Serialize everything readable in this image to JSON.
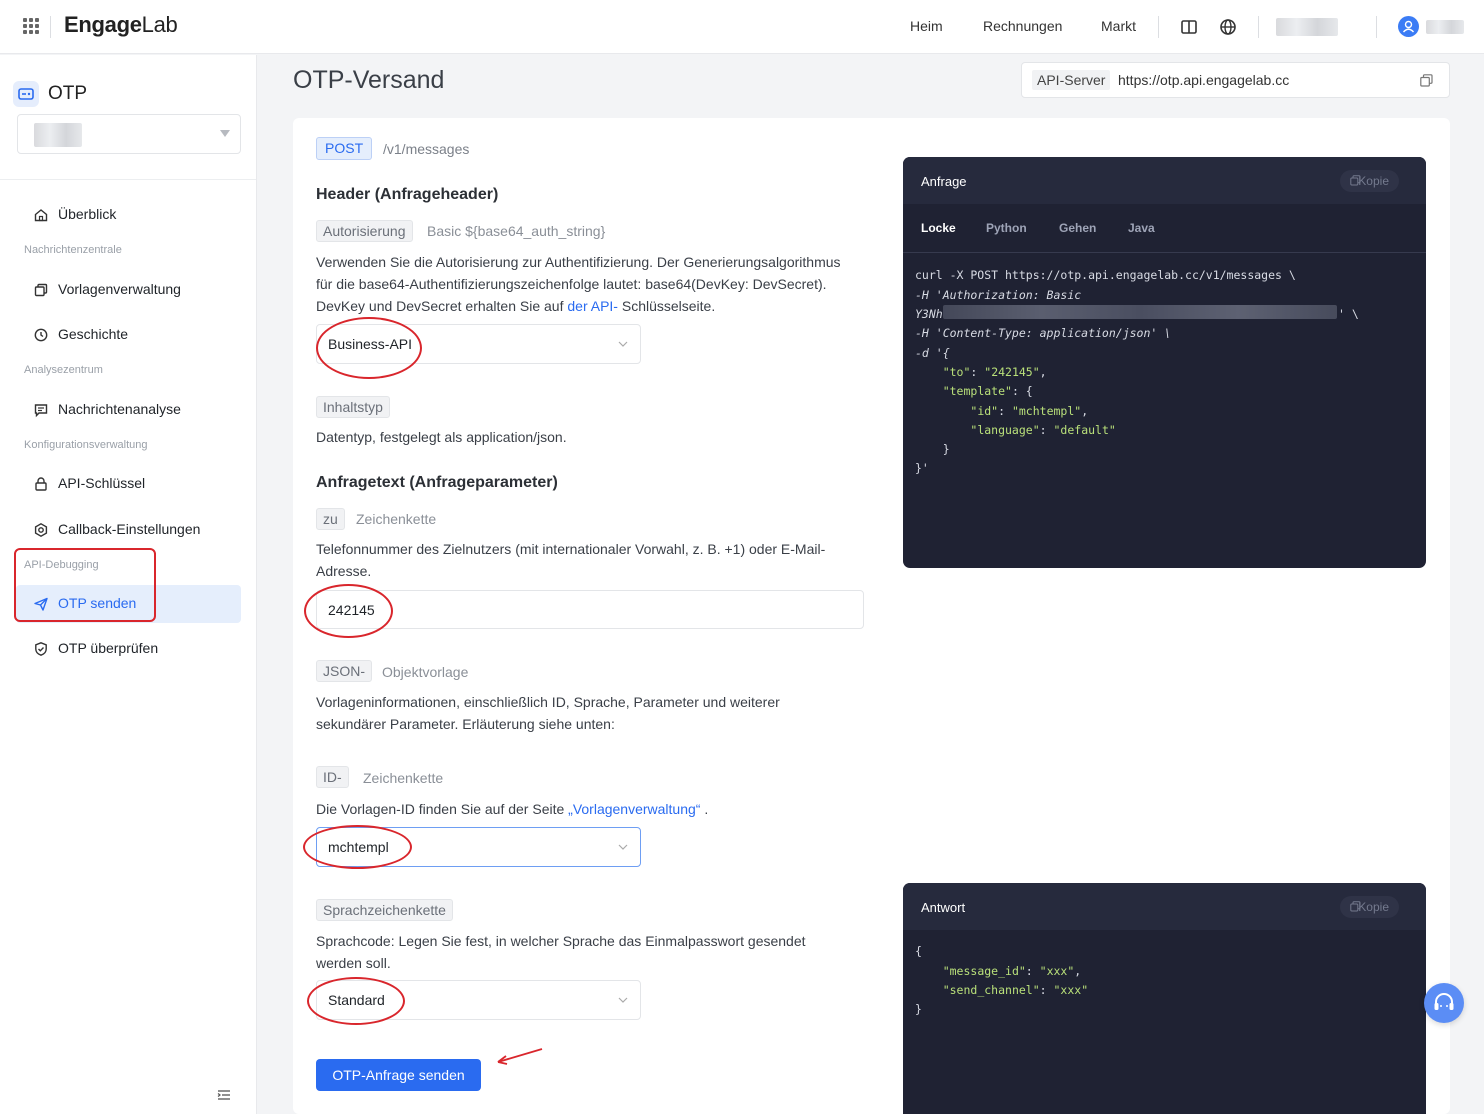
{
  "brand": {
    "logo_main": "Engage",
    "logo_lab": "Lab"
  },
  "topnav": {
    "home": "Heim",
    "billing": "Rechnungen",
    "market": "Markt"
  },
  "sidebar": {
    "product": "OTP",
    "groups": {
      "message_center": "Nachrichtenzentrale",
      "analytics": "Analysezentrum",
      "config": "Konfigurationsverwaltung",
      "api_debug": "API-Debugging"
    },
    "items": {
      "overview": "Überblick",
      "templates": "Vorlagenverwaltung",
      "history": "Geschichte",
      "msg_analysis": "Nachrichtenanalyse",
      "api_keys": "API-Schlüssel",
      "callback": "Callback-Einstellungen",
      "send_otp": "OTP senden",
      "verify_otp": "OTP überprüfen"
    }
  },
  "page": {
    "title": "OTP-Versand"
  },
  "api_server": {
    "label": "API-Server",
    "url": "https://otp.api.engagelab.cc"
  },
  "request": {
    "method": "POST",
    "path": "/v1/messages",
    "header_title": "Header (Anfrageheader)",
    "auth": {
      "name": "Autorisierung",
      "type": "Basic ${base64_auth_string}",
      "desc1": "Verwenden Sie die Autorisierung zur Authentifizierung. Der Generierungsalgorithmus",
      "desc2": "für die base64-Authentifizierungszeichenfolge lautet: base64(DevKey: DevSecret).",
      "desc3_pre": "DevKey und DevSecret erhalten Sie auf ",
      "desc3_link": "der API-",
      "desc3_post": " Schlüsselseite.",
      "select_value": "Business-API"
    },
    "content_type": {
      "name": "Inhaltstyp",
      "desc": "Datentyp, festgelegt als application/json."
    },
    "body_title": "Anfragetext (Anfrageparameter)",
    "to": {
      "name": "zu",
      "type": "Zeichenkette",
      "desc1": "Telefonnummer des Zielnutzers (mit internationaler Vorwahl, z. B. +1) oder E-Mail-",
      "desc2": "Adresse.",
      "value": "242145"
    },
    "template": {
      "name": "JSON-",
      "type": "Objektvorlage",
      "desc1": "Vorlageninformationen, einschließlich ID, Sprache, Parameter und weiterer",
      "desc2": "sekundärer Parameter. Erläuterung siehe unten:"
    },
    "id": {
      "name": "ID-",
      "type": "Zeichenkette",
      "desc_pre": "Die Vorlagen-ID finden Sie auf der Seite ",
      "desc_link": "„Vorlagenverwaltung“",
      "desc_post": " .",
      "value": "mchtempl"
    },
    "language": {
      "name": "Sprachzeichenkette",
      "desc1": "Sprachcode: Legen Sie fest, in welcher Sprache das Einmalpasswort gesendet",
      "desc2": "werden soll.",
      "value": "Standard"
    },
    "send_button": "OTP-Anfrage senden"
  },
  "request_panel": {
    "title": "Anfrage",
    "copy": "Kopie",
    "tabs": [
      "Locke",
      "Python",
      "Gehen",
      "Java"
    ],
    "code": {
      "l1": "curl -X POST https://otp.api.engagelab.cc/v1/messages \\",
      "l2": "-H 'Authorization: Basic",
      "l3a": "Y3Nh",
      "l3b": "' \\",
      "l4": "-H 'Content-Type: application/json' \\",
      "l5": "-d '{",
      "l6k": "\"to\"",
      "l6v": "\"242145\"",
      "l7k": "\"template\"",
      "l8k": "\"id\"",
      "l8v": "\"mchtempl\"",
      "l9k": "\"language\"",
      "l9v": "\"default\"",
      "l10": "}",
      "l11": "}'"
    }
  },
  "response_panel": {
    "title": "Antwort",
    "copy": "Kopie",
    "code": {
      "open": "{",
      "k1": "\"message_id\"",
      "v1": "\"xxx\"",
      "k2": "\"send_channel\"",
      "v2": "\"xxx\"",
      "close": "}"
    }
  },
  "colors": {
    "accent": "#2a6bf0",
    "annotation": "#d9262c",
    "code_bg": "#1f2233"
  }
}
